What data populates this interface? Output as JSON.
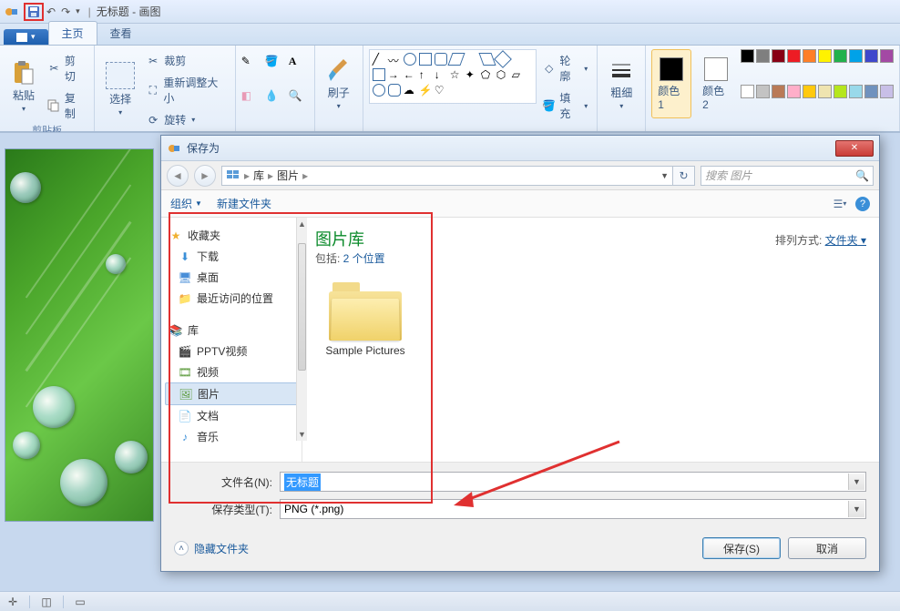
{
  "title": {
    "doc": "无标题",
    "app": "画图"
  },
  "tabs": {
    "file": "",
    "home": "主页",
    "view": "查看"
  },
  "ribbon": {
    "clipboard": {
      "paste": "粘贴",
      "cut": "剪切",
      "copy": "复制",
      "label": "剪贴板"
    },
    "image": {
      "select": "选择",
      "crop": "裁剪",
      "resize": "重新调整大小",
      "rotate": "旋转"
    },
    "tools": {},
    "brush": "刷子",
    "shapes": {
      "outline": "轮廓",
      "fill": "填充"
    },
    "thickness": "粗细",
    "colors": {
      "c1": "颜色 1",
      "c2": "颜色 2"
    }
  },
  "dialog": {
    "title": "保存为",
    "breadcrumb": {
      "root": "库",
      "folder": "图片"
    },
    "search_placeholder": "搜索 图片",
    "toolbar": {
      "organize": "组织",
      "newfolder": "新建文件夹"
    },
    "tree": {
      "favorites": "收藏夹",
      "downloads": "下载",
      "desktop": "桌面",
      "recent": "最近访问的位置",
      "libraries": "库",
      "pptv": "PPTV视频",
      "videos": "视频",
      "pictures": "图片",
      "documents": "文档",
      "music": "音乐"
    },
    "content": {
      "lib_title": "图片库",
      "includes_prefix": "包括: ",
      "includes_link": "2 个位置",
      "arrange_label": "排列方式: ",
      "arrange_value": "文件夹",
      "folder_name": "Sample Pictures"
    },
    "fields": {
      "filename_label": "文件名(N):",
      "filename_value": "无标题",
      "type_label": "保存类型(T):",
      "type_value": "PNG (*.png)"
    },
    "footer": {
      "hide": "隐藏文件夹",
      "save": "保存(S)",
      "cancel": "取消"
    }
  },
  "palette": [
    "#000000",
    "#7f7f7f",
    "#880015",
    "#ed1c24",
    "#ff7f27",
    "#fff200",
    "#22b14c",
    "#00a2e8",
    "#3f48cc",
    "#a349a4",
    "#ffffff",
    "#c3c3c3",
    "#b97a57",
    "#ffaec9",
    "#ffc90e",
    "#efe4b0",
    "#b5e61d",
    "#99d9ea",
    "#7092be",
    "#c8bfe7"
  ]
}
